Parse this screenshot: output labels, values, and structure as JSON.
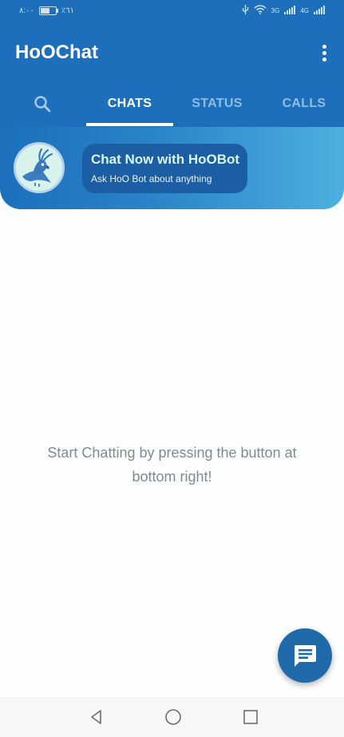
{
  "status_bar": {
    "time": "٨:٠٠",
    "battery": "٪٦١",
    "network_1": "3G",
    "network_2": "4G"
  },
  "header": {
    "title": "HoOChat",
    "menu_icon": "more-vert-icon"
  },
  "tabs": [
    {
      "label": "",
      "icon": "search-icon",
      "active": false
    },
    {
      "label": "CHATS",
      "active": true
    },
    {
      "label": "STATUS",
      "active": false
    },
    {
      "label": "CALLS",
      "active": false
    }
  ],
  "promo": {
    "title": "Chat Now with HoOBot",
    "subtitle": "Ask HoO Bot about anything",
    "avatar_icon": "cockatoo-logo"
  },
  "main": {
    "empty_message": "Start Chatting by pressing the button at bottom right!"
  },
  "fab": {
    "icon": "chat-bubble-icon"
  },
  "nav_bar": {
    "back_icon": "back-triangle-icon",
    "home_icon": "home-circle-icon",
    "recents_icon": "recents-square-icon"
  },
  "colors": {
    "header": "#1d6fbc",
    "fab": "#1f6aa8",
    "empty_text": "#7f8b94",
    "promo_title": "#d9f7ef"
  }
}
